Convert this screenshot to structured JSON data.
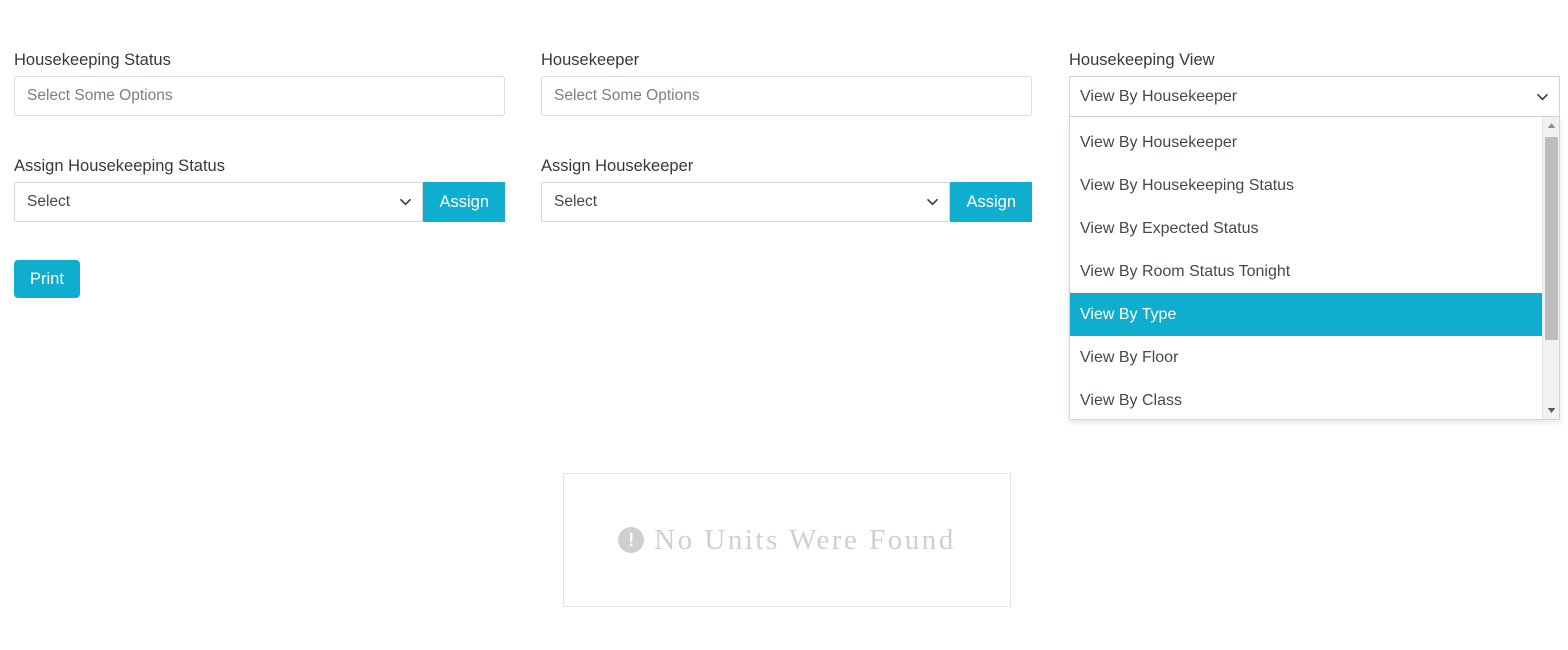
{
  "filters": {
    "housekeeping_status": {
      "label": "Housekeeping Status",
      "placeholder": "Select Some Options",
      "value": ""
    },
    "housekeeper": {
      "label": "Housekeeper",
      "placeholder": "Select Some Options",
      "value": ""
    },
    "housekeeping_view": {
      "label": "Housekeeping View",
      "selected": "View By Housekeeper",
      "options": [
        "View By Housekeeper",
        "View By Housekeeping Status",
        "View By Expected Status",
        "View By Room Status Tonight",
        "View By Type",
        "View By Floor",
        "View By Class"
      ],
      "highlighted": "View By Type",
      "expanded": true
    }
  },
  "assign": {
    "housekeeping_status": {
      "label": "Assign Housekeeping Status",
      "select_value": "Select",
      "button_label": "Assign"
    },
    "housekeeper": {
      "label": "Assign Housekeeper",
      "select_value": "Select",
      "button_label": "Assign"
    }
  },
  "actions": {
    "print_label": "Print"
  },
  "empty_state": {
    "icon": "exclamation-circle-icon",
    "icon_glyph": "!",
    "message": "No  Units  Were  Found"
  },
  "icons": {
    "chevron_down": "chevron-down-icon",
    "scroll_up": "scroll-up-arrow-icon",
    "scroll_down": "scroll-down-arrow-icon"
  },
  "colors": {
    "accent": "#10aece",
    "label_text": "#34393d",
    "placeholder_text": "#7b7f83",
    "empty_text": "#cfcfcf"
  }
}
